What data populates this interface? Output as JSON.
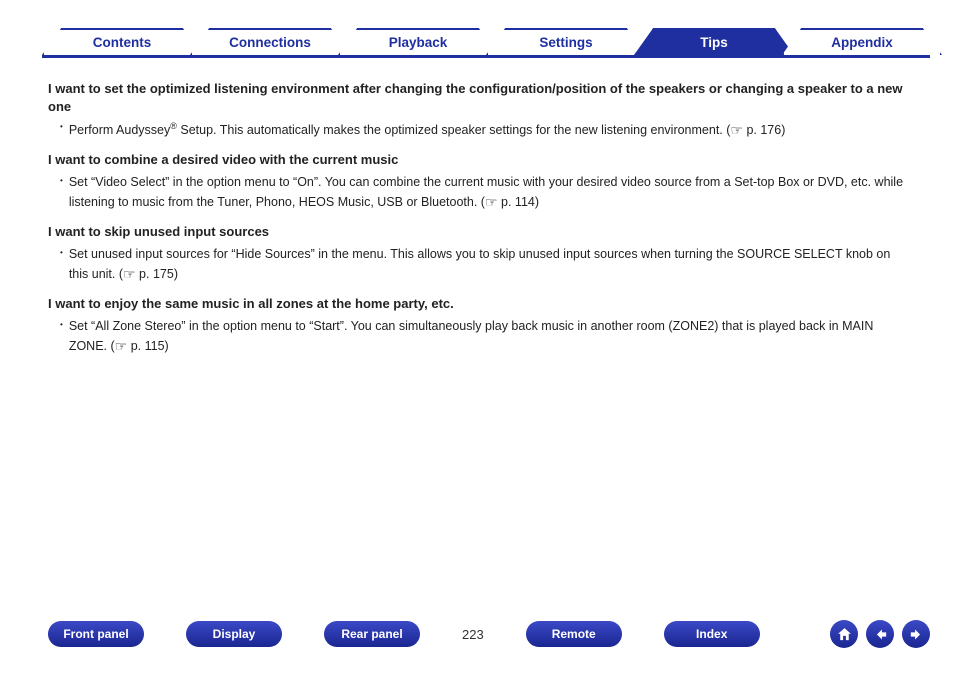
{
  "tabs": [
    {
      "label": "Contents",
      "active": false
    },
    {
      "label": "Connections",
      "active": false
    },
    {
      "label": "Playback",
      "active": false
    },
    {
      "label": "Settings",
      "active": false
    },
    {
      "label": "Tips",
      "active": true
    },
    {
      "label": "Appendix",
      "active": false
    }
  ],
  "topics": [
    {
      "heading": "I want to set the optimized listening environment after changing the configuration/position of the speakers or changing a speaker to a new one",
      "body_pre": "Perform Audyssey",
      "body_sup": "®",
      "body_post": " Setup. This automatically makes the optimized speaker settings for the new listening environment.  (",
      "ref": "p. 176",
      "body_end": ")"
    },
    {
      "heading": "I want to combine a desired video with the current music",
      "body_pre": "Set “Video Select” in the option menu to “On”. You can combine the current music with your desired video source from a Set-top Box or DVD, etc. while listening to music from the Tuner, Phono, HEOS Music, USB or Bluetooth.  (",
      "body_sup": "",
      "body_post": "",
      "ref": "p. 114",
      "body_end": ")"
    },
    {
      "heading": "I want to skip unused input sources",
      "body_pre": "Set unused input sources for “Hide Sources” in the menu. This allows you to skip unused input sources when turning the SOURCE SELECT knob on this unit.  (",
      "body_sup": "",
      "body_post": "",
      "ref": "p. 175",
      "body_end": ")"
    },
    {
      "heading": "I want to enjoy the same music in all zones at the home party, etc.",
      "body_pre": "Set “All Zone Stereo” in the option menu to “Start”. You can simultaneously play back music in another room (ZONE2) that is played back in MAIN ZONE.  (",
      "body_sup": "",
      "body_post": "",
      "ref": "p. 115",
      "body_end": ")"
    }
  ],
  "page_number": "223",
  "bottom_nav": {
    "front_panel": "Front panel",
    "display": "Display",
    "rear_panel": "Rear panel",
    "remote": "Remote",
    "index": "Index"
  },
  "icons": {
    "home": "home-icon",
    "prev": "arrow-left-icon",
    "next": "arrow-right-icon",
    "ref": "pointing-hand-icon"
  }
}
